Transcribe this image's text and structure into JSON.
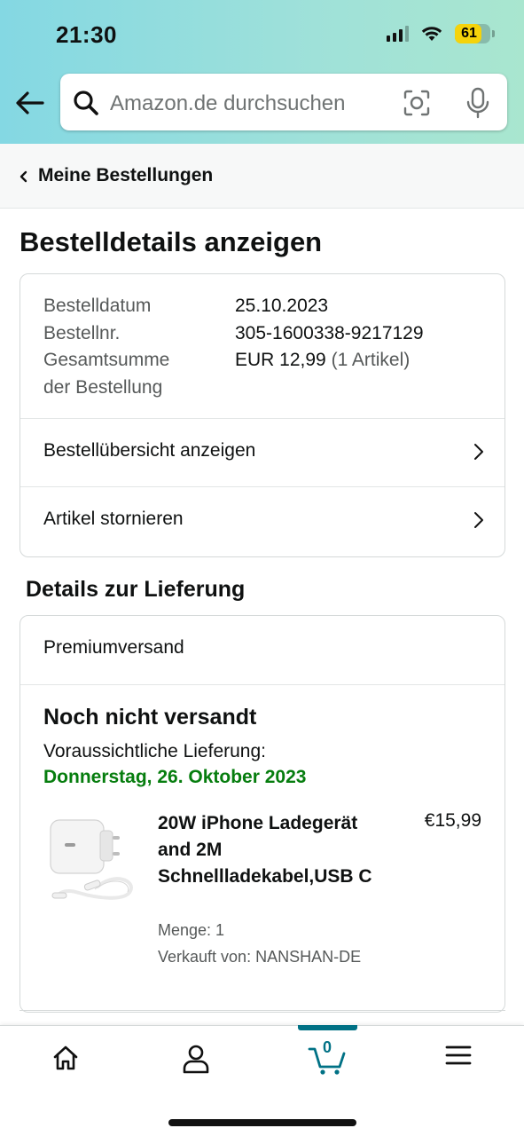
{
  "status_bar": {
    "time": "21:30",
    "battery": "61",
    "signal_bars": 3,
    "icons": [
      "cellular-signal-icon",
      "wifi-icon",
      "battery-icon"
    ]
  },
  "search": {
    "placeholder": "Amazon.de durchsuchen",
    "icons": [
      "back-arrow-icon",
      "search-icon",
      "camera-scan-icon",
      "microphone-icon"
    ]
  },
  "breadcrumb": {
    "label": "Meine Bestellungen"
  },
  "page": {
    "title": "Bestelldetails anzeigen"
  },
  "order": {
    "date_label": "Bestelldatum",
    "date_value": "25.10.2023",
    "number_label": "Bestellnr.",
    "number_value": "305-1600338-9217129",
    "total_label_line1": "Gesamtsumme",
    "total_label_line2": "der Bestellung",
    "total_value": "EUR 12,99",
    "total_items": "(1 Artikel)",
    "links": [
      {
        "label": "Bestellübersicht anzeigen"
      },
      {
        "label": "Artikel stornieren"
      }
    ]
  },
  "delivery": {
    "section_title": "Details zur Lieferung",
    "shipping_method": "Premiumversand",
    "status": "Noch nicht versandt",
    "estimate_label": "Voraussichtliche Lieferung:",
    "estimate_date": "Donnerstag, 26. Oktober 2023",
    "item": {
      "title": "20W iPhone Ladegerät and 2M Schnellladekabel,USB C",
      "price": "€15,99",
      "quantity": "Menge: 1",
      "seller": "Verkauft von: NANSHAN-DE",
      "image": "usb-c-charger-with-cable"
    }
  },
  "bottom_nav": {
    "items": [
      "home-icon",
      "account-icon",
      "cart-icon",
      "menu-icon"
    ],
    "cart_count": "0",
    "active": "cart"
  },
  "colors": {
    "header_gradient_start": "#84d8e3",
    "header_gradient_end": "#a9e6cf",
    "delivery_green": "#067d0e",
    "accent_teal": "#007185",
    "battery_yellow": "#f5d30a"
  }
}
